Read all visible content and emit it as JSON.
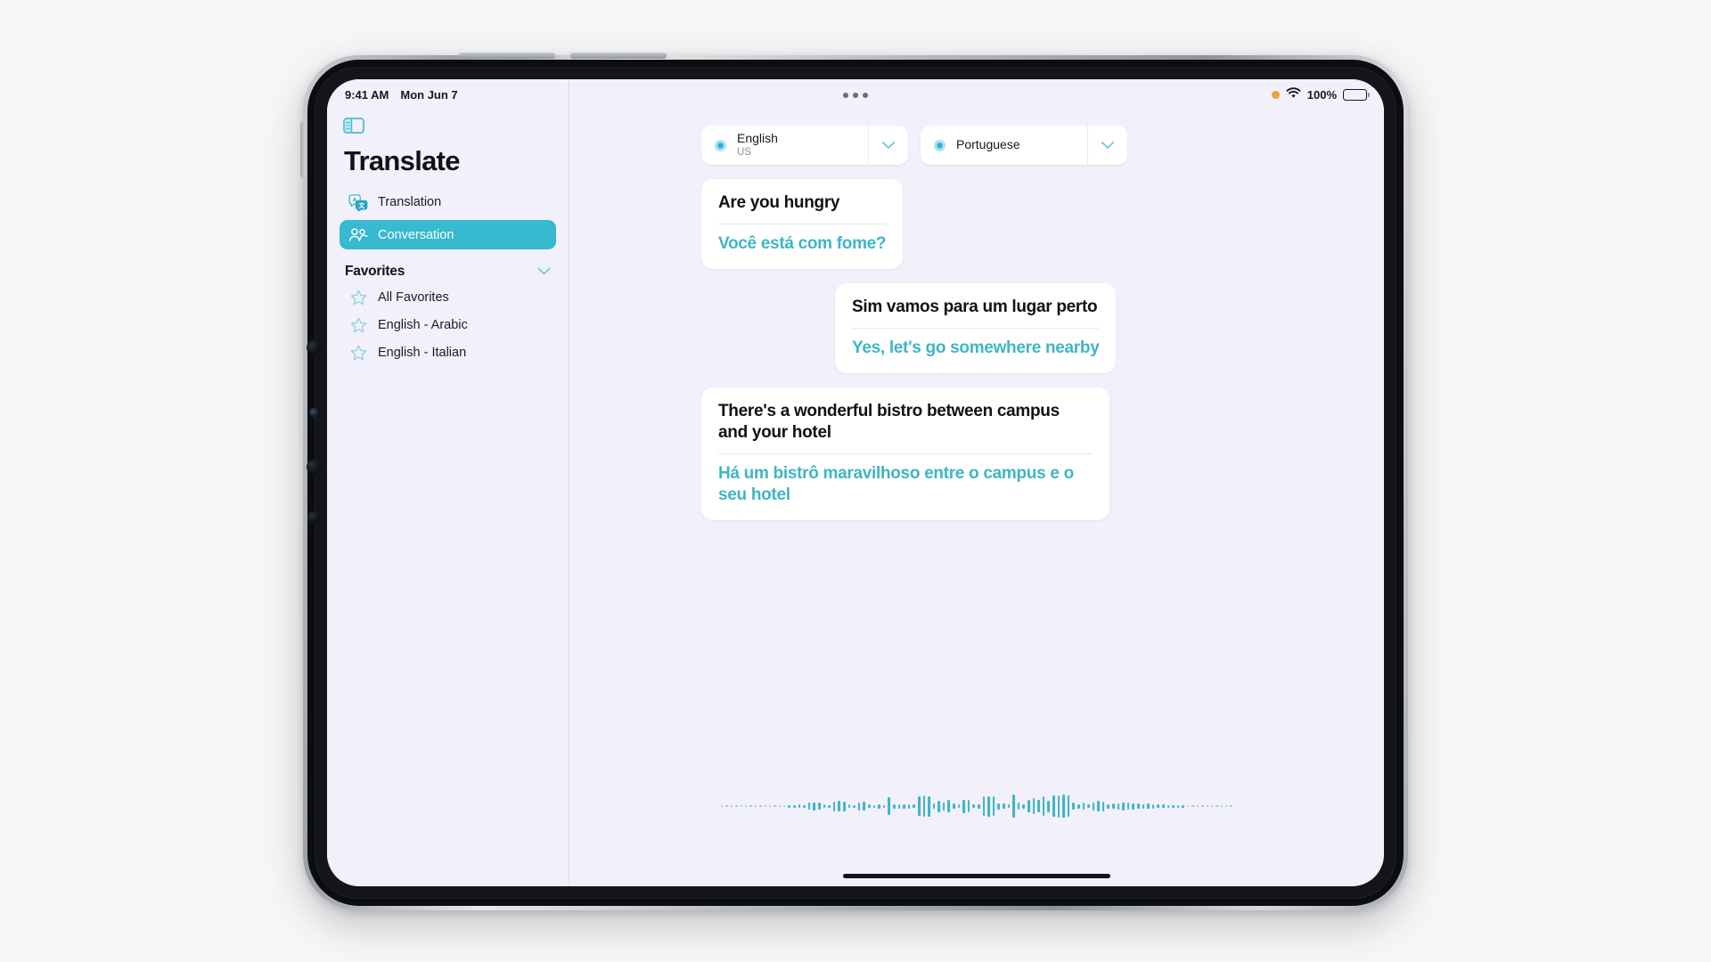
{
  "status_bar": {
    "time": "9:41 AM",
    "date": "Mon Jun 7",
    "battery_percent": "100%",
    "mic_indicator": "orange-dot",
    "wifi_icon": "wifi-icon",
    "multitask_icon": "multitask-dots-icon"
  },
  "sidebar": {
    "toggle_icon": "sidebar-toggle-icon",
    "app_title": "Translate",
    "nav": [
      {
        "label": "Translation",
        "icon": "translation-icon",
        "active": false
      },
      {
        "label": "Conversation",
        "icon": "conversation-people-icon",
        "active": true
      }
    ],
    "favorites_section": {
      "title": "Favorites",
      "chevron_icon": "chevron-down-icon",
      "items": [
        {
          "label": "All Favorites",
          "icon": "star-icon"
        },
        {
          "label": "English - Arabic",
          "icon": "star-icon"
        },
        {
          "label": "English - Italian",
          "icon": "star-icon"
        }
      ]
    }
  },
  "main": {
    "language_selectors": [
      {
        "name": "English",
        "region": "US",
        "mic_icon": "mic-dot-icon",
        "chevron_icon": "chevron-down-icon"
      },
      {
        "name": "Portuguese",
        "region": "",
        "mic_icon": "mic-dot-icon",
        "chevron_icon": "chevron-down-icon"
      }
    ],
    "conversation": [
      {
        "align": "left",
        "source": "Are you hungry",
        "translation": "Você está com fome?"
      },
      {
        "align": "right",
        "source": "Sim vamos para um lugar perto",
        "translation": "Yes, let's go somewhere nearby"
      },
      {
        "align": "left",
        "source": "There's a wonderful bistro between campus and your hotel",
        "translation": "Há um bistrô maravilhoso entre o campus e o seu hotel"
      }
    ],
    "waveform": {
      "name": "listening-waveform",
      "amplitudes": [
        2,
        2,
        2,
        2,
        2,
        2,
        2,
        2,
        2,
        2,
        2,
        2,
        2,
        2,
        3,
        3,
        4,
        3,
        8,
        9,
        8,
        4,
        3,
        11,
        12,
        11,
        4,
        3,
        9,
        10,
        4,
        3,
        5,
        3,
        20,
        5,
        5,
        5,
        5,
        4,
        22,
        24,
        23,
        6,
        13,
        9,
        14,
        6,
        4,
        15,
        14,
        4,
        5,
        22,
        23,
        22,
        7,
        6,
        4,
        26,
        8,
        5,
        14,
        18,
        14,
        22,
        13,
        24,
        25,
        26,
        24,
        8,
        5,
        8,
        4,
        9,
        12,
        11,
        5,
        6,
        7,
        9,
        8,
        7,
        6,
        5,
        6,
        5,
        4,
        4,
        3,
        3,
        3,
        3,
        2,
        2,
        2,
        2,
        2,
        2,
        2,
        2,
        2,
        2
      ]
    },
    "home_indicator": "home-indicator"
  },
  "colors": {
    "accent": "#3fb5c5",
    "active_nav": "#37b9cf",
    "screen_bg": "#f2f0fb",
    "bubble_bg": "#ffffff",
    "mic_orange": "#f0a33a"
  }
}
